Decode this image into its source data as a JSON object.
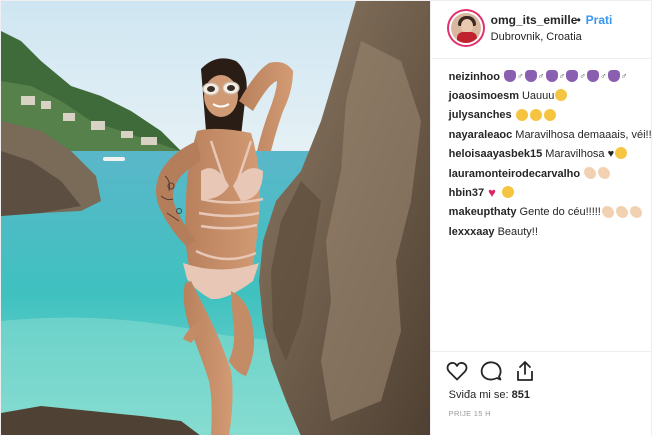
{
  "post": {
    "username": "omg_its_emille",
    "separator": "•",
    "follow_label": "Prati",
    "location": "Dubrovnik, Croatia"
  },
  "comments": [
    {
      "user": "neizinhoo",
      "text": "",
      "emoji": [
        "purple",
        "sym",
        "purple",
        "sym",
        "purple",
        "sym",
        "purple",
        "sym",
        "purple",
        "sym",
        "purple",
        "sym"
      ]
    },
    {
      "user": "joaosimoesm",
      "text": "Uauuu",
      "emoji": [
        "yellow"
      ]
    },
    {
      "user": "julysanches",
      "text": "",
      "emoji": [
        "yellow",
        "yellow",
        "yellow"
      ]
    },
    {
      "user": "nayaraleaoc",
      "text": "Maravilhosa demaaais, véi!!!",
      "emoji": []
    },
    {
      "user": "heloisaayasbek15",
      "text": "Maravilhosa ♥",
      "emoji": [
        "yellow"
      ]
    },
    {
      "user": "lauramonteirodecarvalho",
      "text": "",
      "emoji": [
        "clap",
        "clap"
      ]
    },
    {
      "user": "hbin37",
      "text": "",
      "emoji": [
        "heart",
        "yellow"
      ]
    },
    {
      "user": "makeupthaty",
      "text": "Gente do céu!!!!!",
      "emoji": [
        "clap",
        "clap",
        "clap"
      ]
    },
    {
      "user": "lexxxaay",
      "text": "Beauty!!",
      "emoji": []
    }
  ],
  "footer": {
    "likes_label": "Sviđa mi se:",
    "likes_count": "851",
    "time_ago": "PRIJE 15 H"
  },
  "icons": {
    "like": "heart-outline-icon",
    "comment": "comment-bubble-icon",
    "share": "share-upload-icon"
  },
  "colors": {
    "follow": "#3897f0",
    "story_ring": "#e1306c",
    "divider": "#efefef"
  }
}
